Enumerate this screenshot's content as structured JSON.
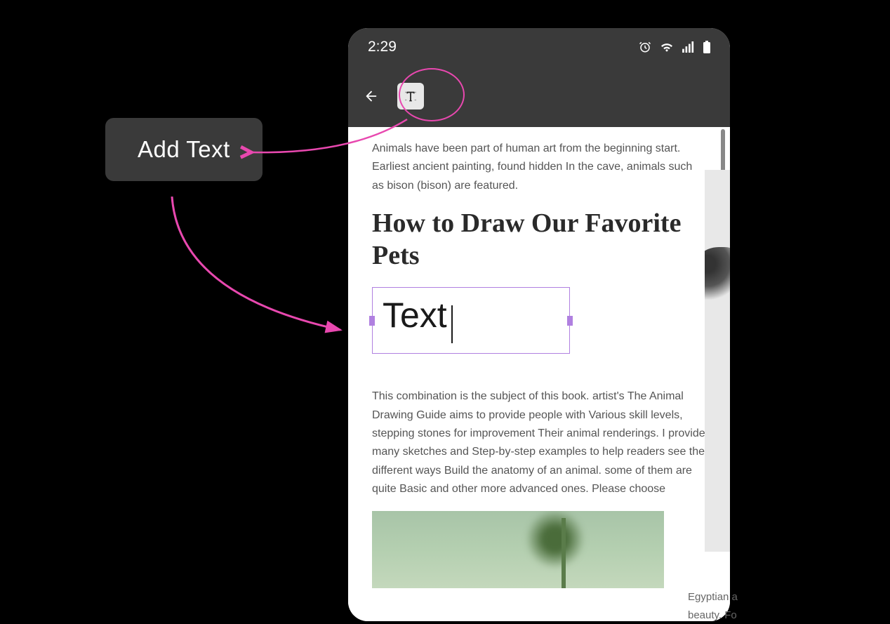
{
  "callout": {
    "label": "Add Text"
  },
  "statusBar": {
    "time": "2:29"
  },
  "content": {
    "paragraph1": "Animals have been part of human art from the beginning start. Earliest ancient painting, found hidden In the cave, animals such as bison (bison) are featured.",
    "heading": "How to Draw Our Favorite Pets",
    "textBoxValue": "Text",
    "paragraph2": "This combination is the subject of this book. artist's The Animal Drawing Guide aims to provide people with Various skill levels, stepping stones for improvement Their animal renderings. I provide many sketches and Step-by-step examples to help readers see the different ways Build the anatomy of an animal. some of them are quite Basic and other more advanced ones. Please choose"
  },
  "sideText": {
    "line1": "Egyptian a",
    "line2": "beauty. Fo"
  },
  "colors": {
    "annotation": "#e848af",
    "selection": "#b080e0",
    "appBar": "#3a3a3a"
  }
}
